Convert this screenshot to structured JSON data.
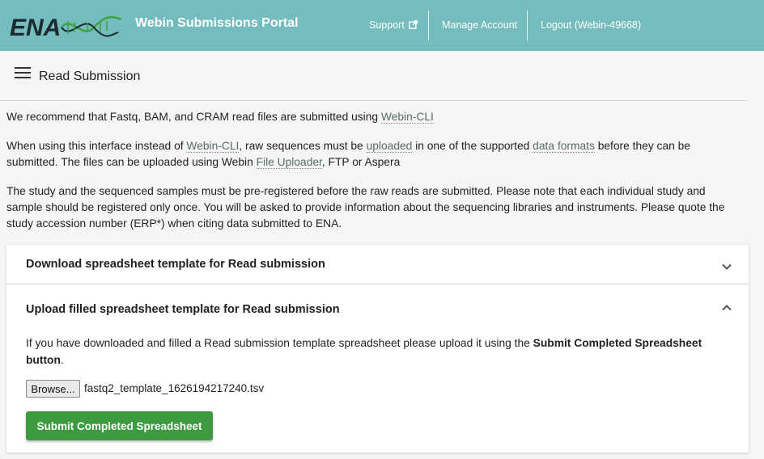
{
  "header": {
    "logo_text": "ENA",
    "title": "Webin Submissions Portal",
    "nav": {
      "support": "Support",
      "manage_account": "Manage Account",
      "logout": "Logout (Webin-49668)"
    }
  },
  "page": {
    "title": "Read Submission"
  },
  "intro": {
    "p1_text": "We recommend that Fastq, BAM, and CRAM read files are submitted using ",
    "p1_link": "Webin-CLI",
    "p2_a": "When using this interface instead of ",
    "p2_link1": "Webin-CLI",
    "p2_b": ", raw sequences must be ",
    "p2_link2": "uploaded",
    "p2_c": " in one of the supported ",
    "p2_link3": "data formats",
    "p2_d": " before they can be submitted. The files can be uploaded using Webin ",
    "p2_link4": "File Uploader",
    "p2_e": ", FTP or Aspera",
    "p3": "The study and the sequenced samples must be pre-registered before the raw reads are submitted. Please note that each individual study and sample should be registered only once. You will be asked to provide information about the sequencing libraries and instruments. Please quote the study accession number (ERP*) when citing data submitted to ENA."
  },
  "download_panel": {
    "title": "Download spreadsheet template for Read submission",
    "expanded": false
  },
  "upload_panel": {
    "title": "Upload filled spreadsheet template for Read submission",
    "expanded": true,
    "text_a": "If you have downloaded and filled a Read submission template spreadsheet please upload it using the ",
    "text_bold": "Submit Completed Spreadsheet button",
    "text_b": ".",
    "browse_label": "Browse...",
    "file_name": "fastq2_template_1626194217240.tsv",
    "submit_label": "Submit Completed Spreadsheet"
  },
  "colors": {
    "header_bg": "#74bcbd",
    "logo_dark": "#1b2a2e",
    "logo_helix": "#3fa046",
    "submit_bg": "#3c9a3f"
  }
}
